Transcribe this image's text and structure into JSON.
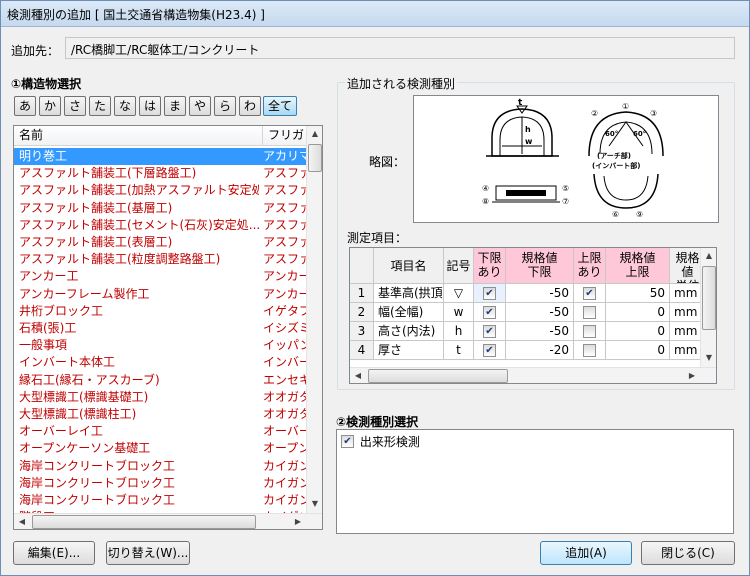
{
  "window": {
    "title": "検測種別の追加 [ 国土交通省構造物集(H23.4) ]"
  },
  "target": {
    "label": "追加先：",
    "value": "/RC橋脚工/RC躯体工/コンクリート"
  },
  "structure_section": {
    "title": "①構造物選択",
    "kana_buttons": [
      "あ",
      "か",
      "さ",
      "た",
      "な",
      "は",
      "ま",
      "や",
      "ら",
      "わ",
      "全て"
    ],
    "selected_kana": "全て",
    "columns": [
      "名前",
      "フリガナ"
    ],
    "rows": [
      {
        "name": "明り巻工",
        "furigana": "アカリマキ",
        "selected": true
      },
      {
        "name": "アスファルト舗装工(下層路盤工)",
        "furigana": "アスファルト"
      },
      {
        "name": "アスファルト舗装工(加熱アスファルト安定処...",
        "furigana": "アスファルト"
      },
      {
        "name": "アスファルト舗装工(基層工)",
        "furigana": "アスファルト"
      },
      {
        "name": "アスファルト舗装工(セメント(石灰)安定処...",
        "furigana": "アスファルト"
      },
      {
        "name": "アスファルト舗装工(表層工)",
        "furigana": "アスファルト"
      },
      {
        "name": "アスファルト舗装工(粒度調整路盤工)",
        "furigana": "アスファルト"
      },
      {
        "name": "アンカー工",
        "furigana": "アンカーコウ"
      },
      {
        "name": "アンカーフレーム製作工",
        "furigana": "アンカーフレ"
      },
      {
        "name": "井桁ブロック工",
        "furigana": "イゲタブロ"
      },
      {
        "name": "石積(張)工",
        "furigana": "イシズミ"
      },
      {
        "name": "一般事項",
        "furigana": "イッパンジ"
      },
      {
        "name": "インバート本体工",
        "furigana": "インバート"
      },
      {
        "name": "縁石工(縁石・アスカーブ)",
        "furigana": "エンセキコ"
      },
      {
        "name": "大型標識工(標識基礎工)",
        "furigana": "オオガタヒ"
      },
      {
        "name": "大型標識工(標識柱工)",
        "furigana": "オオガタヒ"
      },
      {
        "name": "オーバーレイ工",
        "furigana": "オーバーレ"
      },
      {
        "name": "オープンケーソン基礎工",
        "furigana": "オープンケ"
      },
      {
        "name": "海岸コンクリートブロック工",
        "furigana": "カイガンコ"
      },
      {
        "name": "海岸コンクリートブロック工",
        "furigana": "カイガンコ"
      },
      {
        "name": "海岸コンクリートブロック工",
        "furigana": "カイガンコ"
      },
      {
        "name": "階段工",
        "furigana": "カイダンコ"
      }
    ]
  },
  "added_section": {
    "title": "追加される検測種別",
    "sketch_label": "略図：",
    "sketch_marks": {
      "t": "t",
      "h": "h",
      "w": "w",
      "angle_left": "60°",
      "angle_right": "60°",
      "arch": "(アーチ部)",
      "invert": "(インバート部)",
      "num1": "①",
      "num2": "②",
      "num3": "③",
      "num4": "④",
      "num5": "⑤",
      "num6": "⑥",
      "num7": "⑦",
      "num8": "⑧",
      "num9": "⑨"
    },
    "measure_label": "測定項目：",
    "grid_headers": [
      "",
      "項目名",
      "記号",
      "下限\nあり",
      "規格値\n下限",
      "上限\nあり",
      "規格値\n上限",
      "規格値\n単位"
    ],
    "grid_rows": [
      {
        "no": "1",
        "name": "基準高(拱頂)",
        "symbol": "▽",
        "lower_on": true,
        "lower": "-50",
        "upper_on": true,
        "upper": "50",
        "unit": "mm"
      },
      {
        "no": "2",
        "name": "幅(全幅)",
        "symbol": "w",
        "lower_on": true,
        "lower": "-50",
        "upper_on": false,
        "upper": "0",
        "unit": "mm"
      },
      {
        "no": "3",
        "name": "高さ(内法)",
        "symbol": "h",
        "lower_on": true,
        "lower": "-50",
        "upper_on": false,
        "upper": "0",
        "unit": "mm"
      },
      {
        "no": "4",
        "name": "厚さ",
        "symbol": "t",
        "lower_on": true,
        "lower": "-20",
        "upper_on": false,
        "upper": "0",
        "unit": "mm"
      }
    ]
  },
  "type_section": {
    "title": "②検測種別選択",
    "items": [
      {
        "label": "出来形検測",
        "checked": true
      }
    ]
  },
  "buttons": {
    "edit": "編集(E)...",
    "switch": "切り替え(W)...",
    "add": "追加(A)",
    "close": "閉じる(C)"
  }
}
